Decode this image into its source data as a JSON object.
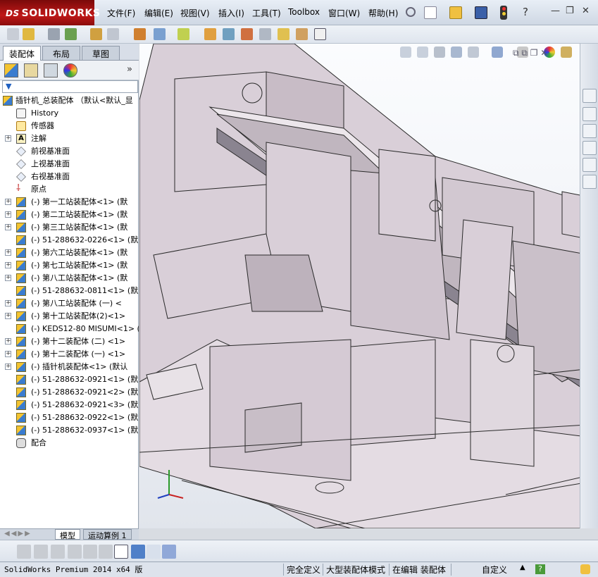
{
  "app": {
    "logo_text": "SOLIDWORKS",
    "logo_prefix": "DS"
  },
  "menu": [
    "文件(F)",
    "编辑(E)",
    "视图(V)",
    "插入(I)",
    "工具(T)",
    "Toolbox",
    "窗口(W)",
    "帮助(H)"
  ],
  "panel_tabs": [
    "装配体",
    "布局",
    "草图"
  ],
  "tree": {
    "root": "插针机_总装配体  （默认<默认_显",
    "items": [
      {
        "label": "History",
        "icon": "history-icon",
        "expand": false
      },
      {
        "label": "传感器",
        "icon": "sensor-icon",
        "expand": false
      },
      {
        "label": "注解",
        "icon": "annotation-icon",
        "expand": true
      },
      {
        "label": "前视基准面",
        "icon": "plane-icon",
        "expand": false
      },
      {
        "label": "上视基准面",
        "icon": "plane-icon",
        "expand": false
      },
      {
        "label": "右视基准面",
        "icon": "plane-icon",
        "expand": false
      },
      {
        "label": "原点",
        "icon": "origin-icon",
        "expand": false
      },
      {
        "label": "(-) 第一工站装配体<1> (默",
        "icon": "assembly-icon",
        "expand": true
      },
      {
        "label": "(-) 第二工站装配体<1> (默",
        "icon": "assembly-icon",
        "expand": true
      },
      {
        "label": "(-) 第三工站装配体<1> (默",
        "icon": "assembly-icon",
        "expand": true
      },
      {
        "label": "(-) 51-288632-0226<1> (默",
        "icon": "part-icon",
        "expand": false
      },
      {
        "label": "(-) 第六工站装配体<1> (默",
        "icon": "assembly-icon",
        "expand": true
      },
      {
        "label": "(-) 第七工站装配体<1> (默",
        "icon": "assembly-icon",
        "expand": true
      },
      {
        "label": "(-) 第八工站装配体<1> (默",
        "icon": "assembly-icon",
        "expand": true
      },
      {
        "label": "(-) 51-288632-0811<1> (默",
        "icon": "part-icon",
        "expand": false
      },
      {
        "label": "(-) 第八工站装配体 (一) <",
        "icon": "assembly-icon",
        "expand": true
      },
      {
        "label": "(-) 第十工站装配体(2)<1>",
        "icon": "assembly-icon",
        "expand": true
      },
      {
        "label": "(-) KEDS12-80 MISUMI<1> (",
        "icon": "part-icon",
        "expand": false
      },
      {
        "label": "(-) 第十二装配体 (二) <1>",
        "icon": "assembly-icon",
        "expand": true
      },
      {
        "label": "(-) 第十二装配体 (一) <1>",
        "icon": "assembly-icon",
        "expand": true
      },
      {
        "label": "(-) 插针机装配体<1> (默认",
        "icon": "assembly-icon",
        "expand": true
      },
      {
        "label": "(-) 51-288632-0921<1> (默",
        "icon": "part-icon",
        "expand": false
      },
      {
        "label": "(-) 51-288632-0921<2> (默",
        "icon": "part-icon",
        "expand": false
      },
      {
        "label": "(-) 51-288632-0921<3> (默",
        "icon": "part-icon",
        "expand": false
      },
      {
        "label": "(-) 51-288632-0922<1> (默",
        "icon": "part-icon",
        "expand": false
      },
      {
        "label": "(-) 51-288632-0937<1> (默",
        "icon": "part-icon",
        "expand": false
      },
      {
        "label": "配合",
        "icon": "mates-icon",
        "expand": false
      }
    ]
  },
  "bottom_tabs": [
    "模型",
    "运动算例 1"
  ],
  "status": {
    "product": "SolidWorks Premium 2014 x64 版",
    "defined": "完全定义",
    "mode": "大型装配体模式",
    "editing": "在编辑 装配体",
    "units": "自定义"
  },
  "colors": {
    "brand": "#c01818",
    "model_fill": "#d9cfd8",
    "model_edge": "#2a2a2a"
  }
}
